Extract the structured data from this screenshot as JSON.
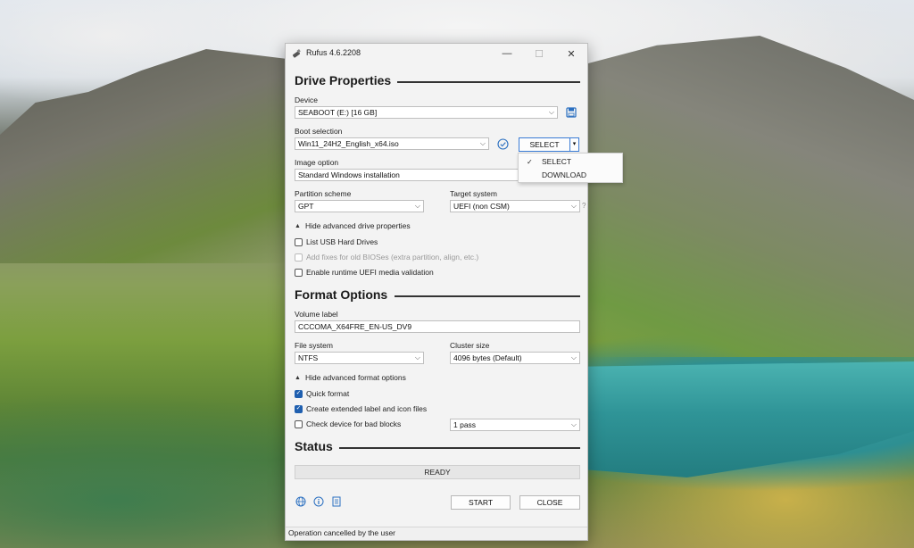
{
  "window": {
    "title": "Rufus 4.6.2208",
    "minimize_glyph": "—",
    "maximize_glyph": "☐",
    "close_glyph": "✕"
  },
  "drive_properties": {
    "heading": "Drive Properties",
    "device_label": "Device",
    "device_value": "SEABOOT (E:) [16 GB]",
    "boot_selection_label": "Boot selection",
    "boot_selection_value": "Win11_24H2_English_x64.iso",
    "select_button": "SELECT",
    "image_option_label": "Image option",
    "image_option_value": "Standard Windows installation",
    "partition_scheme_label": "Partition scheme",
    "partition_scheme_value": "GPT",
    "target_system_label": "Target system",
    "target_system_value": "UEFI (non CSM)",
    "target_help": "?",
    "advanced_toggle": "Hide advanced drive properties",
    "list_usb": "List USB Hard Drives",
    "add_fixes": "Add fixes for old BIOSes (extra partition, align, etc.)",
    "uefi_validation": "Enable runtime UEFI media validation"
  },
  "format_options": {
    "heading": "Format Options",
    "volume_label_label": "Volume label",
    "volume_label_value": "CCCOMA_X64FRE_EN-US_DV9",
    "file_system_label": "File system",
    "file_system_value": "NTFS",
    "cluster_size_label": "Cluster size",
    "cluster_size_value": "4096 bytes (Default)",
    "advanced_toggle": "Hide advanced format options",
    "quick_format": "Quick format",
    "extended_label": "Create extended label and icon files",
    "bad_blocks": "Check device for bad blocks",
    "passes_value": "1 pass"
  },
  "status": {
    "heading": "Status",
    "progress_text": "READY",
    "progress_fraction": 0,
    "start_button": "START",
    "close_button": "CLOSE",
    "footer_text": "Operation cancelled by the user"
  },
  "select_dropdown": {
    "items": [
      "SELECT",
      "DOWNLOAD"
    ],
    "checked_glyph": "✓"
  },
  "checkboxes": {
    "list_usb": false,
    "add_fixes": false,
    "uefi_validation": false,
    "quick_format": true,
    "extended_label": true,
    "bad_blocks": false
  },
  "icons": {
    "app": "usb-drive-icon",
    "save": "save-icon",
    "verify": "check-circle-icon",
    "language": "globe-icon",
    "about": "info-icon",
    "log": "log-icon"
  },
  "colors": {
    "accent": "#1f5faf",
    "window_bg": "#f3f3f3"
  }
}
